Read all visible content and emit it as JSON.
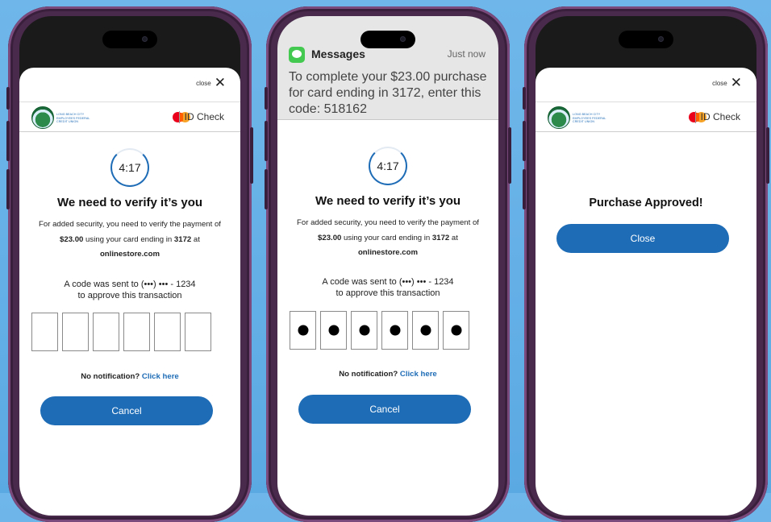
{
  "colors": {
    "accent": "#1e6cb6",
    "background": "#5ba9e3",
    "phone_frame": "#4a2a4c"
  },
  "phones": [
    {
      "close_label": "close",
      "credit_union": "LONG BEACH CITY EMPLOYEES FEDERAL CREDIT UNION",
      "id_check": "ID Check",
      "timer": "4:17",
      "heading": "We need to verify it’s you",
      "security_pre": "For added security, you need to verify the payment of ",
      "amount": "$23.00",
      "security_mid": " using your card ending in ",
      "card_last4": "3172",
      "security_at": " at ",
      "merchant": "onlinestore.com",
      "sent_line1": "A code was sent to (•••) ••• - 1234",
      "sent_line2": "to approve this transaction",
      "no_notification": "No notification?",
      "click_here": "Click here",
      "cancel": "Cancel"
    },
    {
      "message_app": "Messages",
      "message_time": "Just now",
      "message_body": "To complete your $23.00 purchase for card ending in 3172, enter this code: 518162",
      "timer": "4:17",
      "heading": "We need to verify it’s you",
      "security_pre": "For added security, you need to verify the payment of ",
      "amount": "$23.00",
      "security_mid": " using your card ending in ",
      "card_last4": "3172",
      "security_at": " at ",
      "merchant": "onlinestore.com",
      "sent_line1": "A code was sent to (•••) ••• - 1234",
      "sent_line2": "to approve this transaction",
      "no_notification": "No notification?",
      "click_here": "Click here",
      "cancel": "Cancel"
    },
    {
      "close_label": "close",
      "credit_union": "LONG BEACH CITY EMPLOYEES FEDERAL CREDIT UNION",
      "id_check": "ID Check",
      "heading": "Purchase Approved!",
      "close_button": "Close"
    }
  ]
}
